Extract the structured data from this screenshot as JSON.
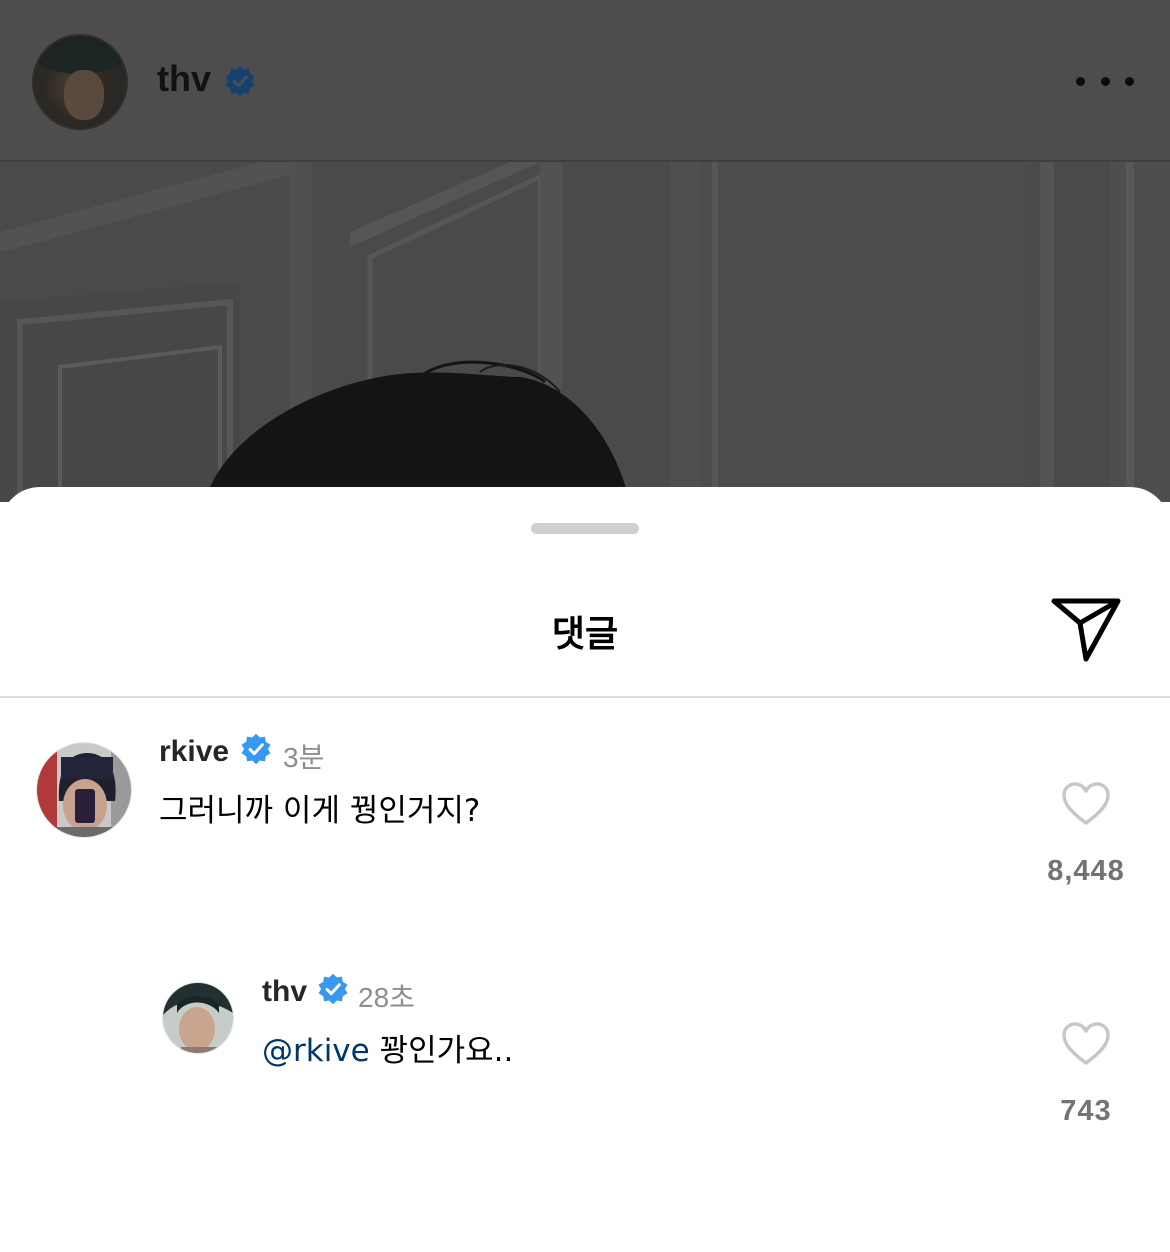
{
  "post": {
    "username": "thv",
    "verified": true,
    "more_icon": "more-horizontal-icon"
  },
  "comments_sheet": {
    "title": "댓글",
    "share_icon": "paper-plane-icon"
  },
  "comments": [
    {
      "username": "rkive",
      "verified": true,
      "time": "3분",
      "text": "그러니까 이게 꿩인거지?",
      "likes": "8,448"
    }
  ],
  "replies": [
    {
      "username": "thv",
      "verified": true,
      "time": "28초",
      "mention": "@rkive",
      "text": " 꽝인가요..",
      "likes": "743"
    }
  ],
  "colors": {
    "verified_blue": "#3897f0",
    "mention_blue": "#00376b",
    "dim_overlay": "#4d4d4d"
  }
}
